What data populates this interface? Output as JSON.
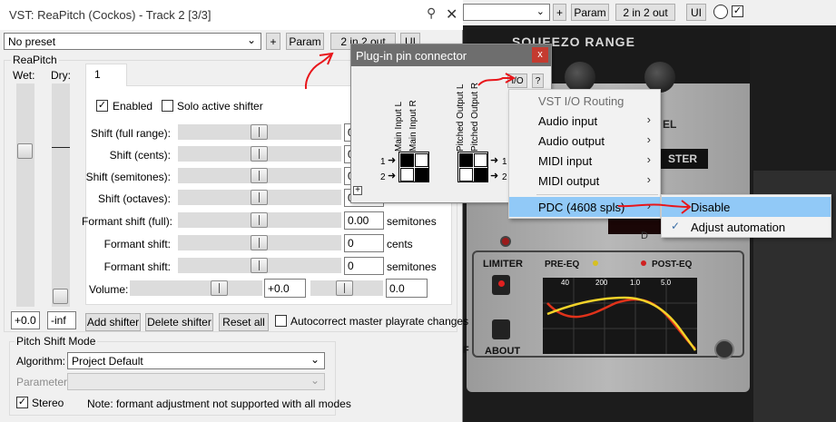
{
  "host_toolbar": {
    "plus": "+",
    "param": "Param",
    "io": "2 in 2 out",
    "ui": "UI"
  },
  "plugin_ui": {
    "name": "SQUEEZO RANGE",
    "el_text": "EL",
    "ster_text": "STER",
    "limiter": "LIMITER",
    "pre_eq": "PRE-EQ",
    "post_eq": "POST-EQ",
    "about": "ABOUT",
    "eq_ticks": [
      "40",
      "200",
      "1.0",
      "5.0"
    ],
    "d_text": "D",
    "f_text": "F"
  },
  "window": {
    "title": "VST: ReaPitch (Cockos) - Track 2 [3/3]",
    "preset": "No preset",
    "plus": "+",
    "param": "Param",
    "io": "2 in 2 out",
    "ui": "UI"
  },
  "reapitch": {
    "group_label": "ReaPitch",
    "wet_label": "Wet:",
    "dry_label": "Dry:",
    "wet_value": "+0.0",
    "dry_value": "-inf",
    "tab": "1",
    "enabled": "Enabled",
    "solo": "Solo active shifter",
    "rows": [
      {
        "label": "Shift (full range):",
        "value": "0",
        "unit": ""
      },
      {
        "label": "Shift (cents):",
        "value": "0",
        "unit": ""
      },
      {
        "label": "Shift (semitones):",
        "value": "0",
        "unit": ""
      },
      {
        "label": "Shift (octaves):",
        "value": "0",
        "unit": ""
      },
      {
        "label": "Formant shift (full):",
        "value": "0.00",
        "unit": "semitones"
      },
      {
        "label": "Formant shift:",
        "value": "0",
        "unit": "cents"
      },
      {
        "label": "Formant shift:",
        "value": "0",
        "unit": "semitones"
      }
    ],
    "volume_label": "Volume:",
    "volume_value": "+0.0",
    "pan_value": "0.0",
    "add_shifter": "Add shifter",
    "delete_shifter": "Delete shifter",
    "reset_all": "Reset all",
    "autocorrect": "Autocorrect master playrate changes"
  },
  "pitch_mode": {
    "group_label": "Pitch Shift Mode",
    "algorithm_label": "Algorithm:",
    "algorithm_value": "Project Default",
    "parameter_label": "Parameter:",
    "stereo_label": "Stereo",
    "note": "Note: formant adjustment not supported with all modes"
  },
  "pin_connector": {
    "title": "Plug-in pin connector",
    "close": "x",
    "io_button": "I/O",
    "help_button": "?",
    "inputs": [
      "Main Input L",
      "Main Input R"
    ],
    "outputs": [
      "Pitched Output L",
      "Pitched Output R"
    ],
    "in_rows": [
      "1",
      "2"
    ],
    "out_rows": [
      "1",
      "2"
    ],
    "plus": "+"
  },
  "io_menu": {
    "header": "VST I/O Routing",
    "items": [
      "Audio input",
      "Audio output",
      "MIDI input",
      "MIDI output"
    ],
    "pdc": "PDC (4608 spls)"
  },
  "pdc_submenu": {
    "items": [
      "Disable",
      "Adjust automation"
    ]
  },
  "colors": {
    "annotation": "#e8161b",
    "menu_highlight": "#91c9f7",
    "eq_red": "#e0321a",
    "eq_yellow": "#f2d229"
  }
}
